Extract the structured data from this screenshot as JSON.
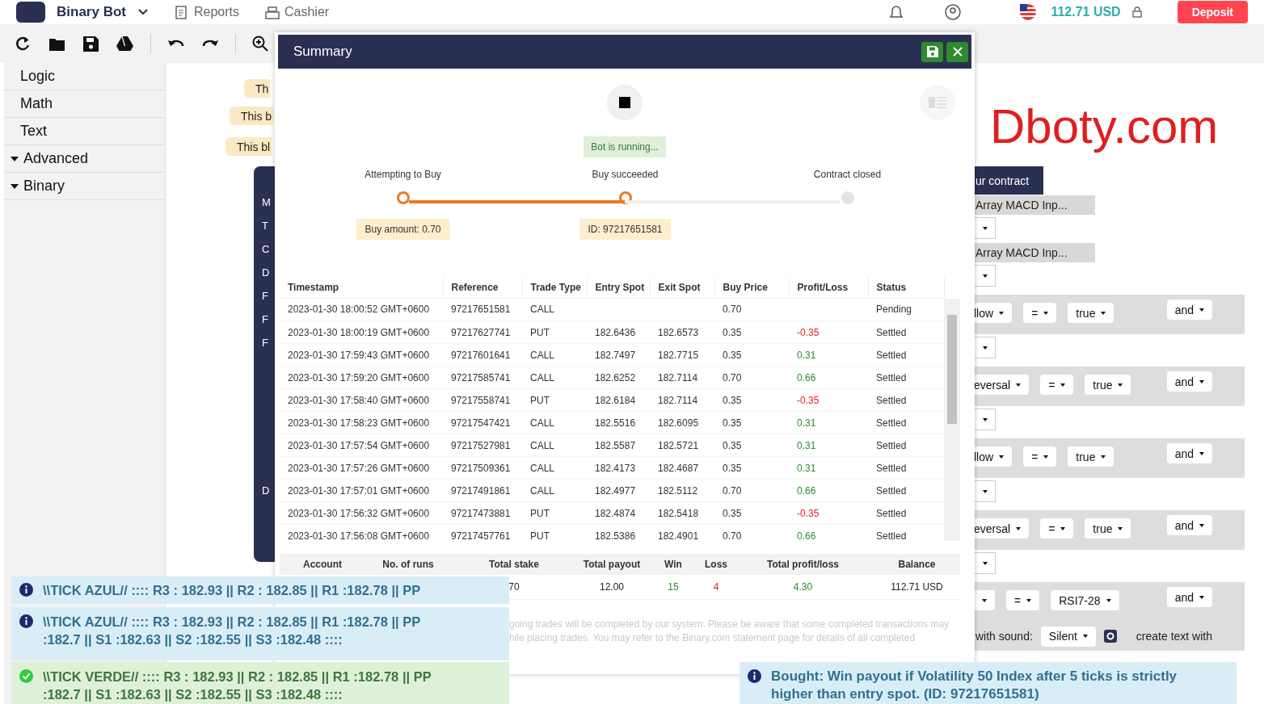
{
  "header": {
    "brand": "Binary Bot",
    "nav": [
      "Reports",
      "Cashier"
    ],
    "balance": "112.71 USD",
    "deposit": "Deposit"
  },
  "sidebar": {
    "items": [
      {
        "label": "Logic",
        "kind": "leaf"
      },
      {
        "label": "Math",
        "kind": "leaf"
      },
      {
        "label": "Text",
        "kind": "leaf"
      },
      {
        "label": "Advanced",
        "kind": "group"
      },
      {
        "label": "Binary",
        "kind": "group"
      }
    ]
  },
  "workspace": {
    "comments": [
      "Th",
      "This b",
      "This bl"
    ],
    "block_labels": [
      {
        "text": "M",
        "kind": "line"
      },
      {
        "text": "T",
        "kind": "line"
      },
      {
        "text": "C",
        "kind": "line"
      },
      {
        "text": "D",
        "kind": "line"
      },
      {
        "text": "F",
        "kind": "line"
      },
      {
        "text": "F",
        "kind": "line"
      },
      {
        "text": "F",
        "kind": "line"
      },
      {
        "text": "D",
        "kind": "spaced"
      }
    ],
    "logo": "Dboty.com",
    "blocks": [
      {
        "kind": "hat",
        "text": "ur contract"
      },
      {
        "kind": "value",
        "text": "Array MACD Inp..."
      },
      {
        "kind": "slot"
      },
      {
        "kind": "value",
        "text": "Array MACD Inp..."
      },
      {
        "kind": "slot"
      },
      {
        "kind": "condition",
        "fields": [
          "llow",
          "=",
          "true"
        ],
        "op": "and"
      },
      {
        "kind": "slot"
      },
      {
        "kind": "condition",
        "fields": [
          "eversal",
          "=",
          "true"
        ],
        "op": "and"
      },
      {
        "kind": "slot"
      },
      {
        "kind": "condition",
        "fields": [
          "llow",
          "=",
          "true"
        ],
        "op": "and"
      },
      {
        "kind": "slot"
      },
      {
        "kind": "condition",
        "fields": [
          "eversal",
          "=",
          "true"
        ],
        "op": "and"
      },
      {
        "kind": "slot"
      },
      {
        "kind": "compare",
        "fields": [
          "=",
          "RSI7-28"
        ],
        "op": "and"
      },
      {
        "kind": "sound",
        "label": "with sound:",
        "value": "Silent",
        "text": "create text with"
      }
    ]
  },
  "summary": {
    "title": "Summary",
    "status": "Bot is running...",
    "progress": {
      "level": 0.5,
      "steps": [
        {
          "label": "Attempting to Buy",
          "note": "Buy amount: 0.70",
          "reached": true
        },
        {
          "label": "Buy succeeded",
          "note": "ID: 97217651581",
          "reached": true
        },
        {
          "label": "Contract closed",
          "reached": false
        }
      ]
    },
    "table": {
      "columns": [
        "Timestamp",
        "Reference",
        "Trade Type",
        "Entry Spot",
        "Exit Spot",
        "Buy Price",
        "Profit/Loss",
        "Status"
      ],
      "rows": [
        {
          "cells": [
            "2023-01-30 18:00:52 GMT+0600",
            "97217651581",
            "CALL",
            "",
            "",
            "0.70",
            "",
            "Pending"
          ]
        },
        {
          "cells": [
            "2023-01-30 18:00:19 GMT+0600",
            "97217627741",
            "PUT",
            "182.6436",
            "182.6573",
            "0.35",
            "-0.35",
            "Settled"
          ],
          "loss": true
        },
        {
          "cells": [
            "2023-01-30 17:59:43 GMT+0600",
            "97217601641",
            "CALL",
            "182.7497",
            "182.7715",
            "0.35",
            "0.31",
            "Settled"
          ],
          "loss": false
        },
        {
          "cells": [
            "2023-01-30 17:59:20 GMT+0600",
            "97217585741",
            "CALL",
            "182.6252",
            "182.7114",
            "0.70",
            "0.66",
            "Settled"
          ],
          "loss": false
        },
        {
          "cells": [
            "2023-01-30 17:58:40 GMT+0600",
            "97217558741",
            "PUT",
            "182.6184",
            "182.7114",
            "0.35",
            "-0.35",
            "Settled"
          ],
          "loss": true
        },
        {
          "cells": [
            "2023-01-30 17:58:23 GMT+0600",
            "97217547421",
            "CALL",
            "182.5516",
            "182.6095",
            "0.35",
            "0.31",
            "Settled"
          ],
          "loss": false
        },
        {
          "cells": [
            "2023-01-30 17:57:54 GMT+0600",
            "97217527981",
            "CALL",
            "182.5587",
            "182.5721",
            "0.35",
            "0.31",
            "Settled"
          ],
          "loss": false
        },
        {
          "cells": [
            "2023-01-30 17:57:26 GMT+0600",
            "97217509361",
            "CALL",
            "182.4173",
            "182.4687",
            "0.35",
            "0.31",
            "Settled"
          ],
          "loss": false
        },
        {
          "cells": [
            "2023-01-30 17:57:01 GMT+0600",
            "97217491861",
            "CALL",
            "182.4977",
            "182.5112",
            "0.70",
            "0.66",
            "Settled"
          ],
          "loss": false
        },
        {
          "cells": [
            "2023-01-30 17:56:32 GMT+0600",
            "97217473881",
            "PUT",
            "182.4874",
            "182.5418",
            "0.35",
            "-0.35",
            "Settled"
          ],
          "loss": true
        },
        {
          "cells": [
            "2023-01-30 17:56:08 GMT+0600",
            "97217457761",
            "PUT",
            "182.5386",
            "182.4901",
            "0.70",
            "0.66",
            "Settled"
          ],
          "loss": false
        }
      ]
    },
    "totals": [
      {
        "heading": "Account"
      },
      {
        "heading": "No. of runs"
      },
      {
        "heading": "Total stake",
        "value": "70"
      },
      {
        "heading": "Total payout",
        "value": "12.00"
      },
      {
        "heading": "Win",
        "value": "15",
        "color": "#2e8b2e"
      },
      {
        "heading": "Loss",
        "value": "4",
        "color": "#e0202a"
      },
      {
        "heading": "Total profit/loss",
        "value": "4.30",
        "color": "#2e8b2e"
      },
      {
        "heading": "Balance",
        "value": "112.71 USD"
      }
    ],
    "disclaimer": "going trades will be completed by our system. Please be aware that some completed transactions may\nhile placing trades. You may refer to the Binary.com statement page for details of all completed"
  },
  "notifications": [
    {
      "kind": "info",
      "text": "\\\\TICK AZUL// :::: R3 : 182.93 || R2 : 182.85 || R1 :182.78 || PP"
    },
    {
      "kind": "info",
      "text": "\\\\TICK AZUL// :::: R3 : 182.93 || R2 : 182.85 || R1 :182.78 || PP\n:182.7 || S1 :182.63 || S2 :182.55 || S3 :182.48 ::::"
    },
    {
      "kind": "success",
      "text": "\\\\TICK VERDE// :::: R3 : 182.93 || R2 : 182.85 || R1 :182.78 || PP\n:182.7 || S1 :182.63 || S2 :182.55 || S3 :182.48 ::::"
    },
    {
      "kind": "info",
      "text": "Bought: Win payout if Volatility 50 Index after 5 ticks is strictly\nhigher than entry spot. (ID: 97217651581)"
    }
  ]
}
